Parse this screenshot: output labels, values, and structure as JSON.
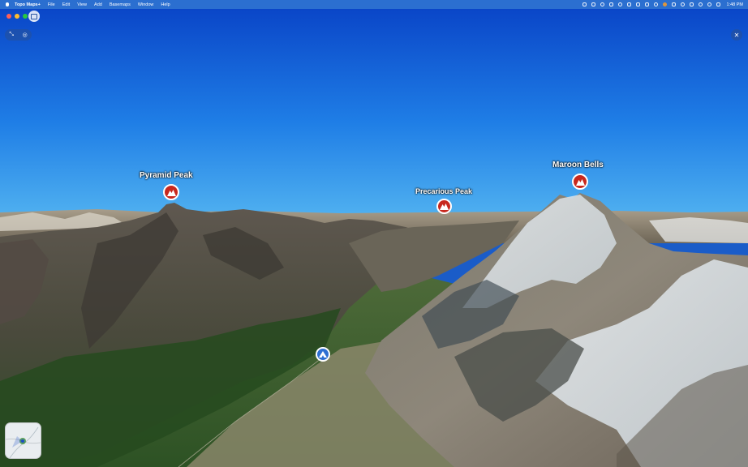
{
  "menubar": {
    "app_name": "Topo Maps+",
    "items": [
      "File",
      "Edit",
      "View",
      "Add",
      "Basemaps",
      "Window",
      "Help"
    ],
    "clock": "1:48 PM"
  },
  "map": {
    "labels": {
      "pyramid_peak": "Pyramid Peak",
      "precarious_peak": "Precarious Peak",
      "maroon_bells": "Maroon Bells"
    }
  },
  "colors": {
    "sky_top": "#0a46c8",
    "sky_horizon": "#4fb0f0",
    "peak_pin": "#c8281e",
    "camp_pin": "#2d6fd2"
  },
  "icons": {
    "peak": "mountain-icon",
    "camp": "tent-icon",
    "close": "close-icon",
    "sidebar": "sidebar-icon"
  }
}
